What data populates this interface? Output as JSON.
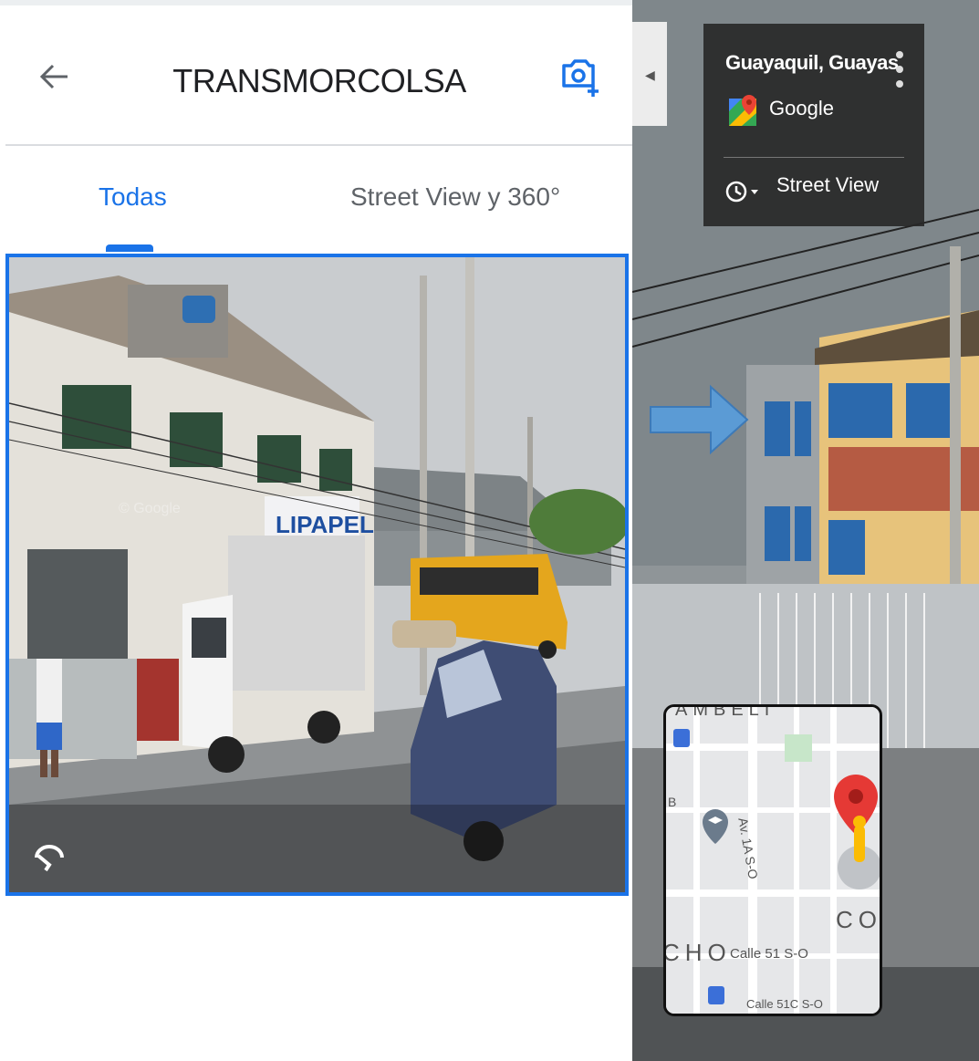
{
  "header": {
    "title": "TRANSMORCOLSA"
  },
  "tabs": [
    {
      "label": "Todas",
      "selected": true
    },
    {
      "label": "Street View y 360°",
      "selected": false
    }
  ],
  "photo": {
    "sign_text": "LIPAPEL",
    "watermark": "© Google"
  },
  "streetview": {
    "location_title": "Guayaquil, Guayas",
    "provider": "Google",
    "mode_label": "Street View"
  },
  "minimap": {
    "street_vertical": "Av. 1A S-O",
    "street_horizontal": "Calle 51 S-O",
    "street_bottom": "Calle 51C S-O",
    "neighborhood_right": "CO",
    "neighborhood_left": "CHO",
    "neighborhood_top": "AMBELI"
  },
  "colors": {
    "accent": "#1a73e8",
    "pin_red": "#e53935",
    "card_bg": "#282828"
  }
}
